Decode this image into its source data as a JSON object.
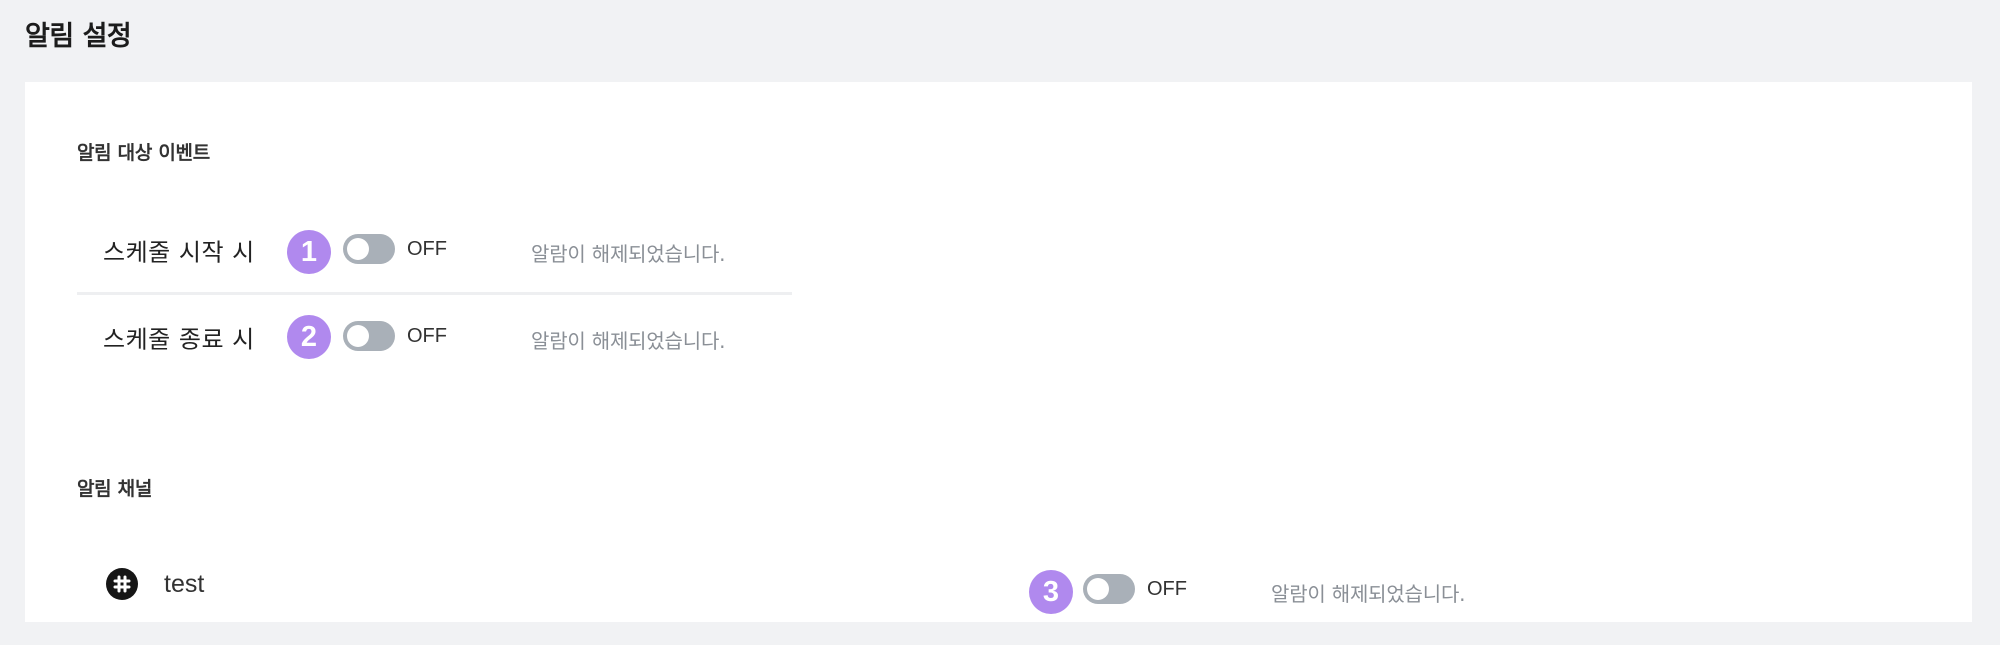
{
  "page": {
    "title": "알림 설정"
  },
  "events_section": {
    "title": "알림 대상 이벤트",
    "items": [
      {
        "label": "스케줄 시작 시",
        "badge": "1",
        "toggle_state": "OFF",
        "status": "알람이 해제되었습니다."
      },
      {
        "label": "스케줄 종료 시",
        "badge": "2",
        "toggle_state": "OFF",
        "status": "알람이 해제되었습니다."
      }
    ]
  },
  "channels_section": {
    "title": "알림 채널",
    "items": [
      {
        "icon": "slack-icon",
        "name": "test",
        "badge": "3",
        "toggle_state": "OFF",
        "status": "알람이 해제되었습니다."
      }
    ]
  },
  "colors": {
    "badge": "#b089ee",
    "toggle_off": "#a9b0b8",
    "background": "#f1f2f4",
    "panel": "#ffffff"
  }
}
